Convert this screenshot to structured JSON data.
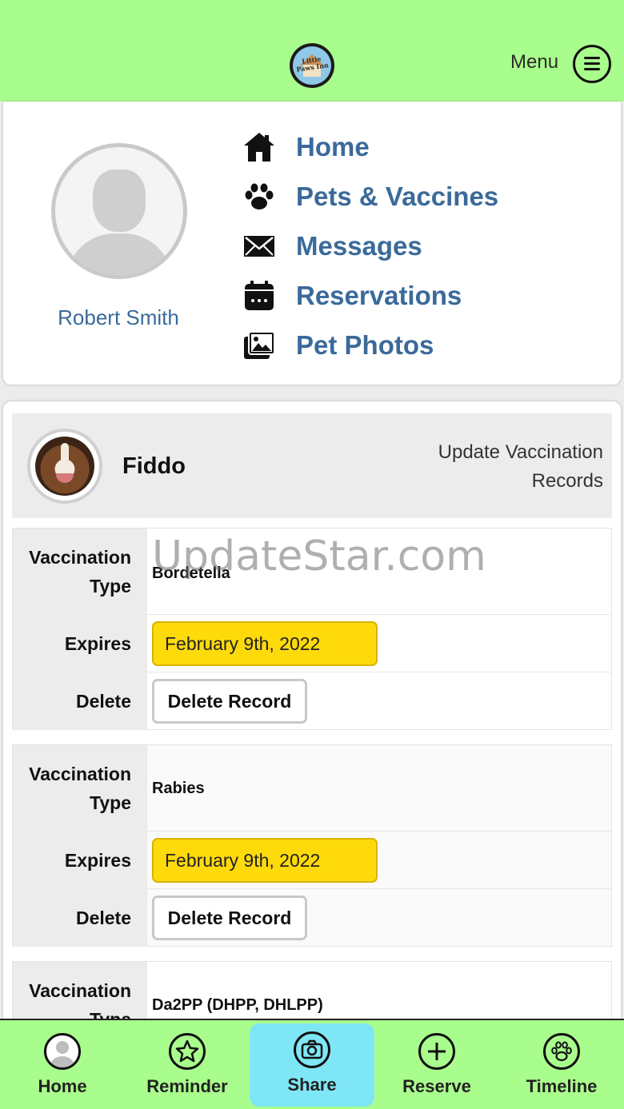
{
  "header": {
    "logo_text": "Little Paws Inn",
    "menu_label": "Menu"
  },
  "profile": {
    "user_name": "Robert Smith",
    "nav": [
      {
        "label": "Home",
        "icon": "home-icon"
      },
      {
        "label": "Pets & Vaccines",
        "icon": "paw-icon"
      },
      {
        "label": "Messages",
        "icon": "envelope-icon"
      },
      {
        "label": "Reservations",
        "icon": "calendar-icon"
      },
      {
        "label": "Pet Photos",
        "icon": "photos-icon"
      }
    ]
  },
  "pet": {
    "name": "Fiddo",
    "update_link": "Update Vaccination Records"
  },
  "labels": {
    "type": "Vaccination Type",
    "expires": "Expires",
    "delete": "Delete",
    "delete_button": "Delete Record"
  },
  "records": [
    {
      "type": "Bordetella",
      "expires": "February 9th, 2022"
    },
    {
      "type": "Rabies",
      "expires": "February 9th, 2022"
    },
    {
      "type": "Da2PP (DHPP, DHLPP)",
      "expires": ""
    }
  ],
  "watermark": "UpdateStar.com",
  "bottom_nav": [
    {
      "label": "Home",
      "icon": "avatar-icon"
    },
    {
      "label": "Reminder",
      "icon": "star-icon"
    },
    {
      "label": "Share",
      "icon": "camera-icon",
      "active": true
    },
    {
      "label": "Reserve",
      "icon": "plus-icon"
    },
    {
      "label": "Timeline",
      "icon": "paw-icon"
    }
  ],
  "colors": {
    "header_green": "#a9fd8c",
    "link_blue": "#3a6a9a",
    "date_yellow": "#ffda0b",
    "active_tab": "#7fe6f6"
  }
}
